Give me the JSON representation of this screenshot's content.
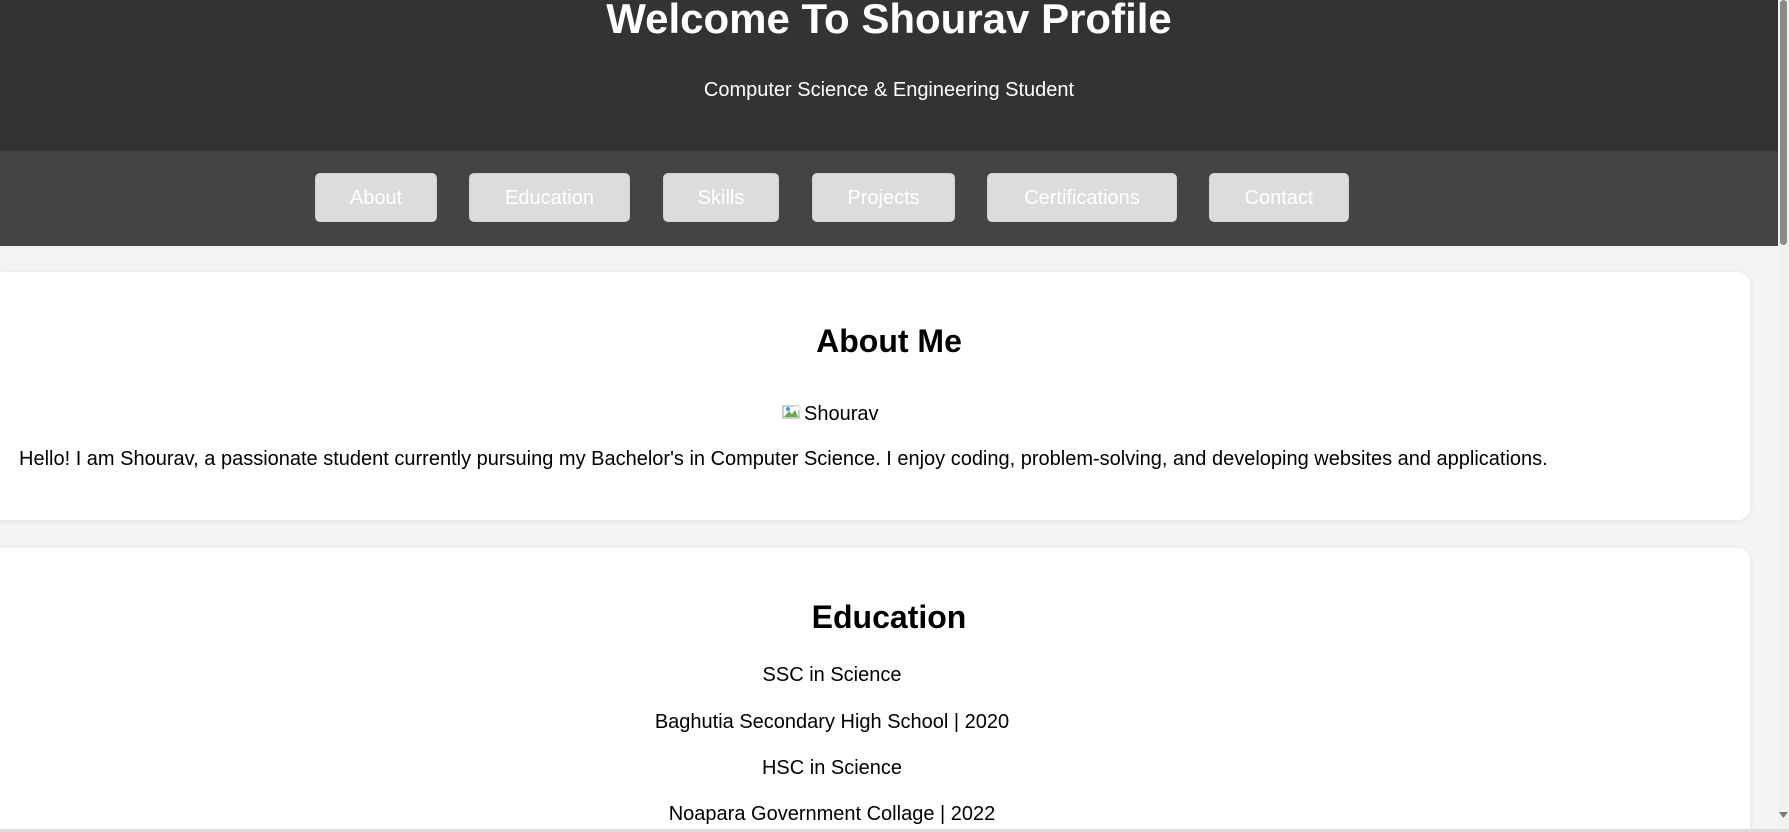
{
  "header": {
    "title": "Welcome To Shourav Profile",
    "subtitle": "Computer Science & Engineering Student"
  },
  "nav": {
    "items": [
      {
        "label": "About"
      },
      {
        "label": "Education"
      },
      {
        "label": "Skills"
      },
      {
        "label": "Projects"
      },
      {
        "label": "Certifications"
      },
      {
        "label": "Contact"
      }
    ]
  },
  "about": {
    "title": "About Me",
    "image_alt": "Shourav",
    "text": "Hello! I am Shourav, a passionate student currently pursuing my Bachelor's in Computer Science. I enjoy coding, problem-solving, and developing websites and applications."
  },
  "education": {
    "title": "Education",
    "entries": [
      {
        "degree": "SSC in Science",
        "institution": "Baghutia Secondary High School | 2020"
      },
      {
        "degree": "HSC in Science",
        "institution": "Noapara Government Collage | 2022"
      }
    ]
  },
  "colors": {
    "header_bg": "#333333",
    "nav_bg": "#444444",
    "nav_button_bg": "#dcdcdc",
    "page_bg": "#f4f4f4",
    "card_bg": "#ffffff"
  },
  "icons": {
    "broken_image": "broken-image-icon",
    "scroll_down": "scroll-down-arrow-icon"
  }
}
